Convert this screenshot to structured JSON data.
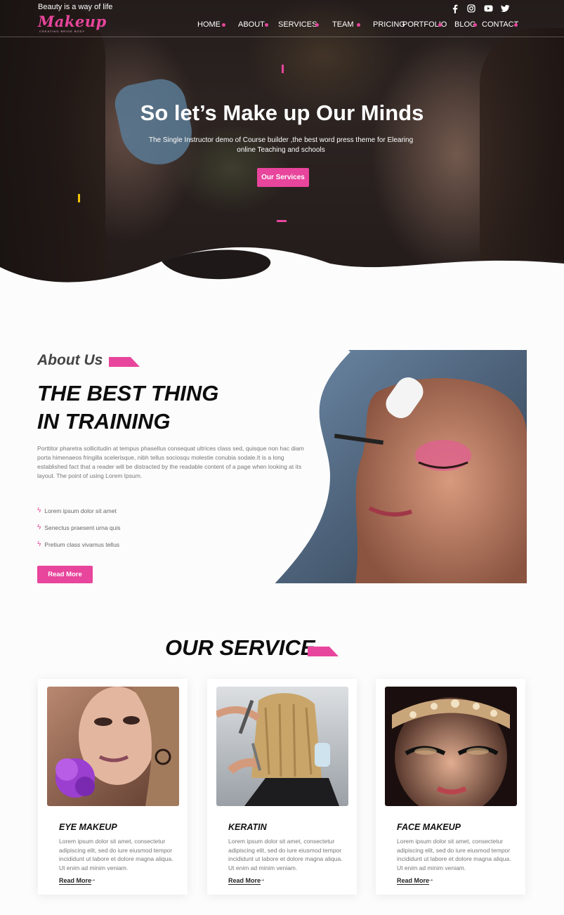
{
  "header": {
    "tagline": "Beauty is a way of life",
    "logo_text": "Makeup",
    "logo_subtext": "CREATING BRIDE BODY",
    "social_icons": [
      "facebook-icon",
      "instagram-icon",
      "youtube-icon",
      "twitter-icon"
    ],
    "nav": [
      "HOME",
      "ABOUT",
      "SERVICES",
      "TEAM",
      "PRICING",
      "PORTFOLIO",
      "BLOG",
      "CONTACT"
    ]
  },
  "hero": {
    "title": "So let’s Make up Our Minds",
    "subtitle": "The Single Instructor demo of Course builder ,the best word press theme for Elearing online Teaching and schools",
    "button": "Our Services"
  },
  "about": {
    "label": "About Us",
    "title_line1": "THE BEST THING",
    "title_line2": "IN TRAINING",
    "paragraph": "Porttitor pharetra sollicitudin at tempus phasellus consequat ultrices class sed, quisque non hac diam porta himenaeos fringilla scelerisque, nibh tellus sociosqu molestie conubia sodale.It is a long established fact that a reader will be distracted by the readable content of a page when looking at its layout. The point of using Lorem Ipsum.",
    "features": [
      "Lorem ipsum dolor sit amet",
      "Senectus praesent urna quis",
      "Pretium class vivamus tellus"
    ],
    "button": "Read More"
  },
  "services": {
    "title": "OUR SERVICE",
    "cards": [
      {
        "title": "EYE MAKEUP",
        "text": "Lorem ipsum dolor sit amet, consectetur adipiscing elit, sed do iure eiusmod tempor incididunt ut labore et dolore magna aliqua. Ut enim ad minim veniam.",
        "link": "Read More"
      },
      {
        "title": "KERATIN",
        "text": "Lorem ipsum dolor sit amet, consectetur adipiscing elit, sed do iure eiusmod tempor incididunt ut labore et dolore magna aliqua. Ut enim ad minim veniam.",
        "link": "Read More"
      },
      {
        "title": "FACE MAKEUP",
        "text": "Lorem ipsum dolor sit amet, consectetur adipiscing elit, sed do iure eiusmod tempor incididunt ut labore et dolore magna aliqua. Ut enim ad minim veniam.",
        "link": "Read More"
      }
    ]
  },
  "colors": {
    "accent": "#e8459c",
    "dark": "#0d0d0d",
    "body_text": "#777777",
    "deco_yellow": "#f2c300"
  }
}
